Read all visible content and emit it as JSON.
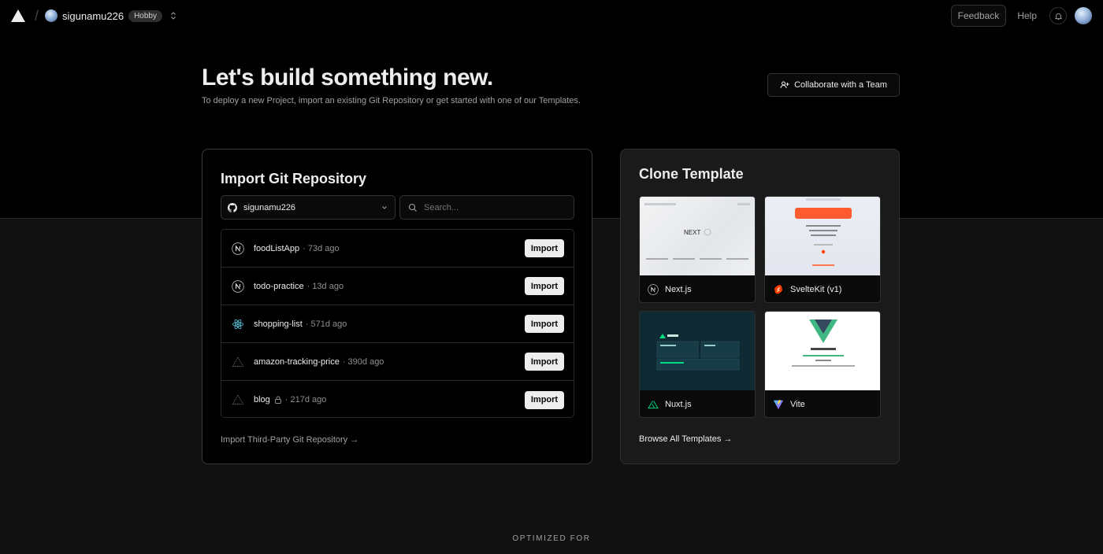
{
  "header": {
    "username": "sigunamu226",
    "plan": "Hobby",
    "feedback_label": "Feedback",
    "help_label": "Help"
  },
  "hero": {
    "title": "Let's build something new.",
    "subtitle": "To deploy a new Project, import an existing Git Repository or get started with one of our Templates.",
    "collaborate_label": "Collaborate with a Team"
  },
  "import_card": {
    "title": "Import Git Repository",
    "account": "sigunamu226",
    "search_placeholder": "Search...",
    "import_label": "Import",
    "repos": [
      {
        "name": "foodListApp",
        "age": "· 73d ago",
        "icon": "nextjs-icon",
        "private": false
      },
      {
        "name": "todo-practice",
        "age": "· 13d ago",
        "icon": "nextjs-icon",
        "private": false
      },
      {
        "name": "shopping-list",
        "age": "· 571d ago",
        "icon": "react-icon",
        "private": false
      },
      {
        "name": "amazon-tracking-price",
        "age": "· 390d ago",
        "icon": "vercel-triangle-icon",
        "private": false
      },
      {
        "name": "blog",
        "age": "· 217d ago",
        "icon": "vercel-triangle-icon",
        "private": true
      }
    ],
    "third_party_label": "Import Third-Party Git Repository →"
  },
  "clone_card": {
    "title": "Clone Template",
    "templates": [
      {
        "name": "Next.js",
        "icon": "nextjs-icon"
      },
      {
        "name": "SvelteKit (v1)",
        "icon": "svelte-icon"
      },
      {
        "name": "Nuxt.js",
        "icon": "nuxt-icon"
      },
      {
        "name": "Vite",
        "icon": "vite-icon"
      }
    ],
    "browse_label": "Browse All Templates →"
  },
  "footer": {
    "optimized_label": "OPTIMIZED FOR"
  },
  "colors": {
    "background": "#111111",
    "top_band": "#000000",
    "text": "#ededed",
    "muted": "#a1a1a1",
    "button_light": "#ededed"
  }
}
